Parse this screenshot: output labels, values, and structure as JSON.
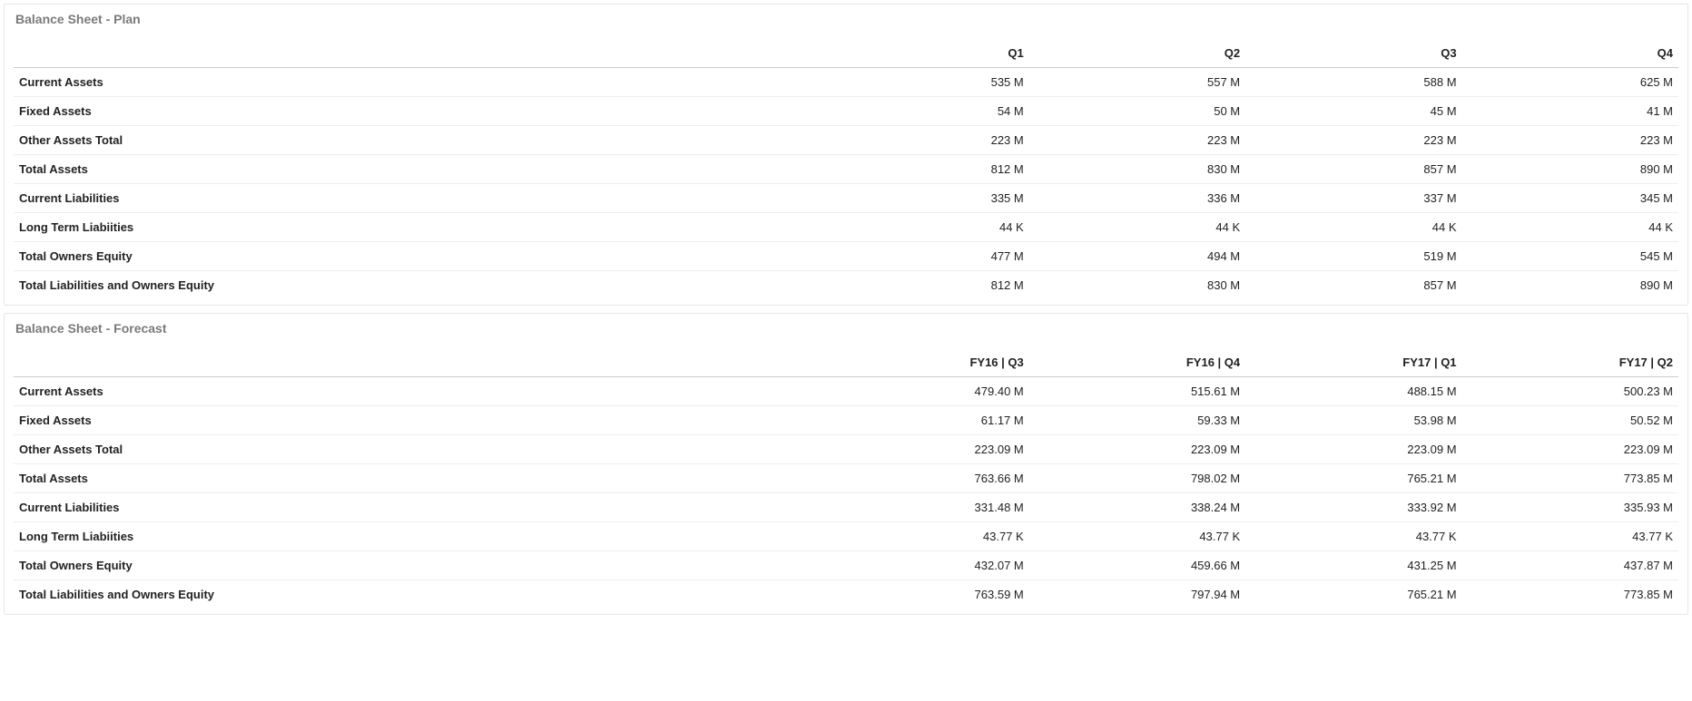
{
  "plan": {
    "title": "Balance Sheet - Plan",
    "headers": [
      "",
      "Q1",
      "Q2",
      "Q3",
      "Q4"
    ],
    "rows": [
      {
        "label": "Current Assets",
        "q1": "535 M",
        "q2": "557 M",
        "q3": "588 M",
        "q4": "625 M"
      },
      {
        "label": "Fixed Assets",
        "q1": "54 M",
        "q2": "50 M",
        "q3": "45 M",
        "q4": "41 M"
      },
      {
        "label": "Other Assets Total",
        "q1": "223 M",
        "q2": "223 M",
        "q3": "223 M",
        "q4": "223 M"
      },
      {
        "label": "Total Assets",
        "q1": "812 M",
        "q2": "830 M",
        "q3": "857 M",
        "q4": "890 M"
      },
      {
        "label": "Current Liabilities",
        "q1": "335 M",
        "q2": "336 M",
        "q3": "337 M",
        "q4": "345 M"
      },
      {
        "label": "Long Term Liabiities",
        "q1": "44 K",
        "q2": "44 K",
        "q3": "44 K",
        "q4": "44 K"
      },
      {
        "label": "Total Owners Equity",
        "q1": "477 M",
        "q2": "494 M",
        "q3": "519 M",
        "q4": "545 M"
      },
      {
        "label": "Total Liabilities and Owners Equity",
        "q1": "812 M",
        "q2": "830 M",
        "q3": "857 M",
        "q4": "890 M"
      }
    ]
  },
  "forecast": {
    "title": "Balance Sheet - Forecast",
    "headers": [
      "",
      "FY16 | Q3",
      "FY16 | Q4",
      "FY17 | Q1",
      "FY17 | Q2"
    ],
    "rows": [
      {
        "label": "Current Assets",
        "q1": "479.40 M",
        "q2": "515.61 M",
        "q3": "488.15 M",
        "q4": "500.23 M"
      },
      {
        "label": "Fixed Assets",
        "q1": "61.17 M",
        "q2": "59.33 M",
        "q3": "53.98 M",
        "q4": "50.52 M"
      },
      {
        "label": "Other Assets Total",
        "q1": "223.09 M",
        "q2": "223.09 M",
        "q3": "223.09 M",
        "q4": "223.09 M"
      },
      {
        "label": "Total Assets",
        "q1": "763.66 M",
        "q2": "798.02 M",
        "q3": "765.21 M",
        "q4": "773.85 M"
      },
      {
        "label": "Current Liabilities",
        "q1": "331.48 M",
        "q2": "338.24 M",
        "q3": "333.92 M",
        "q4": "335.93 M"
      },
      {
        "label": "Long Term Liabiities",
        "q1": "43.77 K",
        "q2": "43.77 K",
        "q3": "43.77 K",
        "q4": "43.77 K"
      },
      {
        "label": "Total Owners Equity",
        "q1": "432.07 M",
        "q2": "459.66 M",
        "q3": "431.25 M",
        "q4": "437.87 M"
      },
      {
        "label": "Total Liabilities and Owners Equity",
        "q1": "763.59 M",
        "q2": "797.94 M",
        "q3": "765.21 M",
        "q4": "773.85 M"
      }
    ]
  }
}
